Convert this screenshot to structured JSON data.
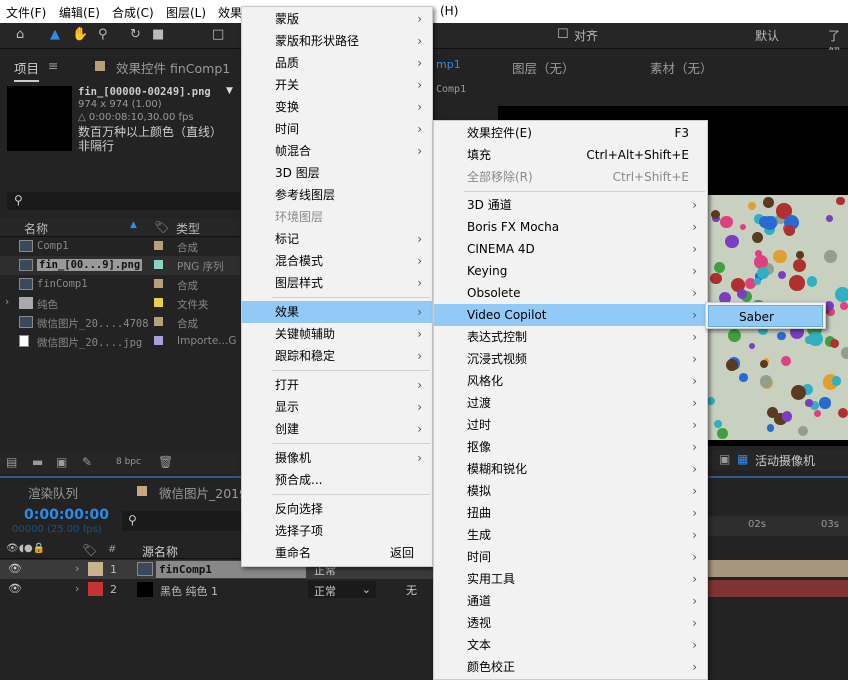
{
  "menubar": {
    "items": [
      "文件(F)",
      "编辑(E)",
      "合成(C)",
      "图层(L)",
      "效果",
      "(H)"
    ]
  },
  "toolbar": {
    "snap_label": "对齐",
    "workspace_default": "默认",
    "workspace_learn": "了解"
  },
  "project_panel": {
    "tab_project": "项目",
    "tab_effects": "效果控件 finComp1",
    "selected_name": "fin_[00000-00249].png",
    "dimensions": "974 x 974 (1.00)",
    "duration": "△ 0:00:08:10,30.00 fps",
    "color_info": "数百万种以上颜色（直线）",
    "field_info": "非隔行",
    "col_name": "名称",
    "col_type": "类型",
    "bpc": "8 bpc",
    "items": [
      {
        "name": "Comp1",
        "type": "合成",
        "color": "#b5a07a"
      },
      {
        "name": "fin_[00...9].png",
        "type": "PNG 序列",
        "color": "#8fd1c2"
      },
      {
        "name": "finComp1",
        "type": "合成",
        "color": "#b5a07a"
      },
      {
        "name": "纯色",
        "type": "文件夹",
        "color": "#e4d34a"
      },
      {
        "name": "微信图片_20....4708",
        "type": "合成",
        "color": "#b5a07a"
      },
      {
        "name": "微信图片_20....jpg",
        "type": "Importe...G",
        "color": "#a9a0d6"
      }
    ]
  },
  "viewer": {
    "tab_comp": "mp1",
    "tab_layer": "图层（无）",
    "tab_footage": "素材（无）",
    "breadcrumb": "Comp1",
    "camera": "活动摄像机"
  },
  "timeline": {
    "tab_render": "渲染队列",
    "tab_comp": "微信图片_2019",
    "timecode": "0:00:00:00",
    "frames": "00000 (25.00 fps)",
    "col_source": "源名称",
    "col_num": "#",
    "ticks": [
      "02s",
      "03s"
    ],
    "layers": [
      {
        "num": "1",
        "name": "finComp1",
        "mode": "正常",
        "color": "#c8b48a"
      },
      {
        "num": "2",
        "name": "黑色 纯色 1",
        "mode": "正常",
        "parent": "无",
        "color": "#c83232"
      }
    ]
  },
  "layer_menu": {
    "items": [
      "蒙版",
      "蒙版和形状路径",
      "品质",
      "开关",
      "变换",
      "时间",
      "帧混合",
      "3D 图层",
      "参考线图层",
      "环境图层",
      "标记",
      "混合模式",
      "图层样式",
      "效果",
      "关键帧辅助",
      "跟踪和稳定",
      "打开",
      "显示",
      "创建",
      "摄像机",
      "预合成...",
      "反向选择",
      "选择子项",
      "重命名"
    ],
    "rename_shortcut": "返回"
  },
  "effect_menu": {
    "effect_controls": "效果控件(E)",
    "effect_controls_key": "F3",
    "fill": "填充",
    "fill_key": "Ctrl+Alt+Shift+E",
    "remove_all": "全部移除(R)",
    "remove_all_key": "Ctrl+Shift+E",
    "categories": [
      "3D 通道",
      "Boris FX Mocha",
      "CINEMA 4D",
      "Keying",
      "Obsolete",
      "Video Copilot",
      "表达式控制",
      "沉浸式视频",
      "风格化",
      "过渡",
      "过时",
      "抠像",
      "模糊和锐化",
      "模拟",
      "扭曲",
      "生成",
      "时间",
      "实用工具",
      "通道",
      "透视",
      "文本",
      "颜色校正"
    ]
  },
  "vc_menu": {
    "items": [
      "Saber"
    ]
  }
}
